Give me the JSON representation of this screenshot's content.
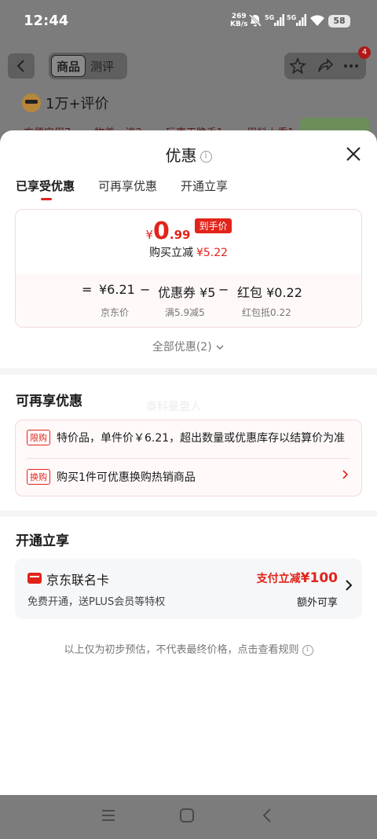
{
  "status_bar": {
    "time": "12:44",
    "net_speed_value": "269",
    "net_speed_unit": "KB/s",
    "signal1": "5G",
    "signal2": "5G",
    "battery": "58"
  },
  "background_page": {
    "tab_product": "商品",
    "tab_review": "测评",
    "cart_badge": "4",
    "reviews_text": "1万+评价",
    "tags": [
      "方便实用7",
      "物美一流3",
      "玩声干脆手1",
      "用料上乘1"
    ]
  },
  "sheet": {
    "title": "优惠",
    "info_glyph": "i",
    "tabs": [
      "已享受优惠",
      "可再享优惠",
      "开通立享"
    ],
    "price": {
      "currency": "¥",
      "integer": "0",
      "decimal": ".99",
      "tag": "到手价",
      "reduce_label": "购买立减",
      "reduce_value": "¥5.22"
    },
    "formula": {
      "eq": "=",
      "jd_price": "¥6.21",
      "minus1": "−",
      "coupon": "优惠券 ¥5",
      "minus2": "−",
      "redpacket": "红包 ¥0.22",
      "jd_price_label": "京东价",
      "coupon_label": "满5.9减5",
      "redpacket_label": "红包抵0.22"
    },
    "all_deals": "全部优惠(2)",
    "section_more": "可再享优惠",
    "watermark": "泰科曼盘人",
    "deals": [
      {
        "pill": "限购",
        "text": "特价品，单件价￥6.21，超出数量或优惠库存以结算价为准"
      },
      {
        "pill": "换购",
        "text": "购买1件可优惠换购热销商品"
      }
    ],
    "section_open": "开通立享",
    "card": {
      "name": "京东联名卡",
      "desc": "免费开通，送PLUS会员等特权",
      "promo_label": "支付立减",
      "promo_value": "¥100",
      "extra": "额外可享"
    },
    "footnote": "以上仅为初步预估，不代表最终价格，点击查看规则"
  },
  "colors": {
    "accent_red": "#e2231a",
    "sheet_bg": "#ffffff",
    "overlay": "#7c7c7c"
  }
}
